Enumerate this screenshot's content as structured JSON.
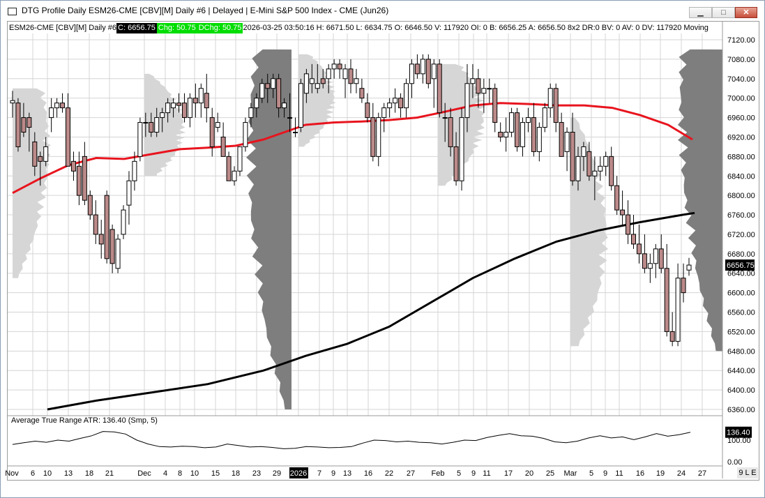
{
  "window": {
    "title": "DTG Profile Daily ESM26-CME [CBV][M]  Daily #6 | Delayed | E-Mini S&P 500 Index - CME (Jun26)",
    "minimize_glyph": "▁",
    "maximize_glyph": "□",
    "close_glyph": "✕"
  },
  "infobar": {
    "symbol": "ESM26-CME [CBV][M]  Daily #6 ",
    "last": "C: 6656.75",
    "chg": "Chg: 50.75",
    "dchg": "DChg: 50.75",
    "rest": " 2026-03-25 03:50:16 H: 6671.50 L: 6634.75 O: 6646.50 V: 117920 OI: 0 B: 6656.25 A: 6656.50 8x2 DR:0 BV: 0 AV: 0 DV: 117920 Moving"
  },
  "atr_panel": {
    "label": "Average True Range  ATR: 136.40   (Smp, 5)",
    "value_tag": "136.40"
  },
  "corner_button": "9 L E",
  "colors": {
    "up_candle": "#ffffff",
    "down_candle": "#bc8a8a",
    "ma_fast": "#e8141e",
    "ma_slow": "#000000",
    "profile_light": "#d6d6d6",
    "profile_dark": "#7e7e7e",
    "grid": "#d4d4d4",
    "last_price_tag": "#000000"
  },
  "chart_data": {
    "type": "candlestick",
    "price_axis": {
      "ylim": [
        6320,
        7140
      ],
      "ticks": [
        "7120.00",
        "7080.00",
        "7040.00",
        "7000.00",
        "6960.00",
        "6920.00",
        "6880.00",
        "6840.00",
        "6800.00",
        "6760.00",
        "6720.00",
        "6680.00",
        "6640.00",
        "6600.00",
        "6560.00",
        "6520.00",
        "6480.00",
        "6440.00",
        "6400.00",
        "6360.00"
      ],
      "last_price_label": "6656.75",
      "last_price": 6656.75
    },
    "date_axis": {
      "labels": [
        "Nov",
        "6",
        "10",
        "13",
        "18",
        "21",
        "Dec",
        "4",
        "8",
        "10",
        "15",
        "18",
        "23",
        "29",
        "2026",
        "7",
        "9",
        "13",
        "16",
        "22",
        "27",
        "Feb",
        "5",
        "9",
        "11",
        "17",
        "20",
        "25",
        "Mar",
        "5",
        "9",
        "11",
        "16",
        "19",
        "24",
        "27"
      ]
    },
    "candles": [
      [
        6990,
        7015,
        6960,
        6995
      ],
      [
        6990,
        7000,
        6890,
        6900
      ],
      [
        6960,
        6990,
        6920,
        6930
      ],
      [
        6960,
        6970,
        6890,
        6940
      ],
      [
        6910,
        6930,
        6840,
        6860
      ],
      [
        6880,
        6890,
        6820,
        6870
      ],
      [
        6870,
        6920,
        6860,
        6900
      ],
      [
        6960,
        7000,
        6930,
        6980
      ],
      [
        6980,
        7000,
        6960,
        6990
      ],
      [
        6990,
        7010,
        6970,
        6980
      ],
      [
        6980,
        7010,
        6860,
        6860
      ],
      [
        6870,
        6890,
        6830,
        6850
      ],
      [
        6860,
        6890,
        6780,
        6800
      ],
      [
        6880,
        6910,
        6780,
        6790
      ],
      [
        6800,
        6810,
        6750,
        6760
      ],
      [
        6760,
        6790,
        6700,
        6720
      ],
      [
        6720,
        6750,
        6670,
        6700
      ],
      [
        6800,
        6810,
        6660,
        6670
      ],
      [
        6730,
        6740,
        6640,
        6660
      ],
      [
        6650,
        6720,
        6640,
        6710
      ],
      [
        6720,
        6780,
        6710,
        6770
      ],
      [
        6780,
        6850,
        6740,
        6830
      ],
      [
        6830,
        6890,
        6810,
        6870
      ],
      [
        6880,
        6960,
        6870,
        6950
      ],
      [
        6950,
        6970,
        6920,
        6950
      ],
      [
        6950,
        6970,
        6920,
        6930
      ],
      [
        6930,
        6980,
        6920,
        6960
      ],
      [
        6960,
        6980,
        6930,
        6970
      ],
      [
        6970,
        7000,
        6950,
        6990
      ],
      [
        6980,
        7000,
        6960,
        6990
      ],
      [
        6990,
        7010,
        6970,
        6985
      ],
      [
        6990,
        7010,
        6950,
        6960
      ],
      [
        6960,
        7010,
        6940,
        7000
      ],
      [
        7000,
        7030,
        6960,
        6990
      ],
      [
        6990,
        7030,
        6960,
        7020
      ],
      [
        7010,
        7050,
        6950,
        6980
      ],
      [
        6960,
        6980,
        6880,
        6900
      ],
      [
        6940,
        6970,
        6930,
        6950
      ],
      [
        6920,
        6950,
        6880,
        6880
      ],
      [
        6880,
        6890,
        6830,
        6830
      ],
      [
        6830,
        6860,
        6820,
        6850
      ],
      [
        6850,
        6900,
        6840,
        6900
      ],
      [
        6900,
        6960,
        6890,
        6950
      ],
      [
        6960,
        6990,
        6940,
        6980
      ],
      [
        6980,
        7010,
        6960,
        7000
      ],
      [
        7000,
        7040,
        6990,
        7030
      ],
      [
        7030,
        7050,
        6990,
        7020
      ],
      [
        7020,
        7050,
        7000,
        7040
      ],
      [
        7040,
        7050,
        6960,
        6980
      ],
      [
        6980,
        7000,
        6960,
        6990
      ],
      [
        6960,
        7010,
        6930,
        6960
      ],
      [
        6930,
        6960,
        6920,
        6930
      ],
      [
        6940,
        7040,
        6930,
        7030
      ],
      [
        7010,
        7060,
        6990,
        7050
      ],
      [
        7030,
        7070,
        7010,
        7040
      ],
      [
        7020,
        7070,
        7010,
        7030
      ],
      [
        7040,
        7060,
        7020,
        7030
      ],
      [
        7040,
        7070,
        7010,
        7060
      ],
      [
        7060,
        7080,
        7040,
        7070
      ],
      [
        7070,
        7080,
        7040,
        7060
      ],
      [
        7040,
        7070,
        7000,
        7060
      ],
      [
        7060,
        7080,
        7010,
        7030
      ],
      [
        7030,
        7060,
        7010,
        7040
      ],
      [
        7020,
        7040,
        6990,
        7000
      ],
      [
        6990,
        7010,
        6950,
        6960
      ],
      [
        6960,
        6990,
        6870,
        6880
      ],
      [
        6880,
        6970,
        6860,
        6960
      ],
      [
        6960,
        6990,
        6930,
        6980
      ],
      [
        6980,
        7000,
        6960,
        6990
      ],
      [
        6990,
        7020,
        6970,
        7000
      ],
      [
        7000,
        7010,
        6960,
        6980
      ],
      [
        6980,
        7040,
        6960,
        7030
      ],
      [
        7030,
        7080,
        7000,
        7070
      ],
      [
        7070,
        7090,
        7040,
        7050
      ],
      [
        7050,
        7090,
        7030,
        7080
      ],
      [
        7080,
        7090,
        7020,
        7030
      ],
      [
        7040,
        7080,
        6980,
        7070
      ],
      [
        7070,
        7080,
        6960,
        6970
      ],
      [
        6960,
        6990,
        6910,
        6960
      ],
      [
        6960,
        6980,
        6880,
        6900
      ],
      [
        6900,
        6930,
        6820,
        6830
      ],
      [
        6830,
        6980,
        6810,
        6960
      ],
      [
        6960,
        7070,
        6930,
        7030
      ],
      [
        7030,
        7070,
        7000,
        7040
      ],
      [
        7040,
        7060,
        6980,
        7010
      ],
      [
        7010,
        7040,
        6970,
        7020
      ],
      [
        7020,
        7040,
        6990,
        7020
      ],
      [
        7020,
        7030,
        6930,
        6950
      ],
      [
        6930,
        6950,
        6910,
        6920
      ],
      [
        6920,
        6960,
        6890,
        6930
      ],
      [
        6930,
        6980,
        6920,
        6970
      ],
      [
        6970,
        6980,
        6890,
        6900
      ],
      [
        6900,
        6960,
        6880,
        6950
      ],
      [
        6950,
        6980,
        6930,
        6960
      ],
      [
        6960,
        6990,
        6880,
        6890
      ],
      [
        6890,
        6950,
        6870,
        6940
      ],
      [
        6940,
        6990,
        6930,
        6980
      ],
      [
        6980,
        7030,
        6960,
        7020
      ],
      [
        7020,
        7030,
        6930,
        6950
      ],
      [
        6950,
        6970,
        6880,
        6880
      ],
      [
        6890,
        6940,
        6850,
        6930
      ],
      [
        6930,
        6970,
        6820,
        6830
      ],
      [
        6830,
        6900,
        6810,
        6880
      ],
      [
        6880,
        6910,
        6850,
        6900
      ],
      [
        6890,
        6910,
        6830,
        6840
      ],
      [
        6840,
        6880,
        6790,
        6850
      ],
      [
        6850,
        6880,
        6830,
        6860
      ],
      [
        6860,
        6890,
        6840,
        6880
      ],
      [
        6880,
        6900,
        6810,
        6820
      ],
      [
        6820,
        6840,
        6760,
        6770
      ],
      [
        6770,
        6810,
        6740,
        6760
      ],
      [
        6760,
        6790,
        6700,
        6720
      ],
      [
        6720,
        6760,
        6690,
        6700
      ],
      [
        6700,
        6740,
        6660,
        6680
      ],
      [
        6680,
        6720,
        6640,
        6650
      ],
      [
        6650,
        6680,
        6620,
        6660
      ],
      [
        6660,
        6700,
        6630,
        6690
      ],
      [
        6690,
        6720,
        6640,
        6650
      ],
      [
        6650,
        6700,
        6510,
        6520
      ],
      [
        6520,
        6560,
        6490,
        6500
      ],
      [
        6500,
        6660,
        6490,
        6630
      ],
      [
        6630,
        6660,
        6580,
        6600
      ],
      [
        6646.5,
        6671.5,
        6634.75,
        6656.75
      ]
    ],
    "ma_fast_points": [
      [
        0,
        6805
      ],
      [
        40,
        6835
      ],
      [
        80,
        6862
      ],
      [
        120,
        6877
      ],
      [
        160,
        6875
      ],
      [
        200,
        6885
      ],
      [
        240,
        6895
      ],
      [
        280,
        6898
      ],
      [
        320,
        6902
      ],
      [
        360,
        6915
      ],
      [
        400,
        6935
      ],
      [
        420,
        6945
      ],
      [
        460,
        6950
      ],
      [
        500,
        6952
      ],
      [
        540,
        6955
      ],
      [
        580,
        6960
      ],
      [
        620,
        6972
      ],
      [
        660,
        6985
      ],
      [
        700,
        6990
      ],
      [
        740,
        6988
      ],
      [
        780,
        6985
      ],
      [
        820,
        6985
      ],
      [
        860,
        6980
      ],
      [
        900,
        6965
      ],
      [
        940,
        6945
      ],
      [
        975,
        6915
      ]
    ],
    "ma_slow_points": [
      [
        50,
        6360
      ],
      [
        120,
        6378
      ],
      [
        200,
        6395
      ],
      [
        280,
        6412
      ],
      [
        360,
        6440
      ],
      [
        420,
        6470
      ],
      [
        480,
        6495
      ],
      [
        540,
        6530
      ],
      [
        600,
        6580
      ],
      [
        660,
        6630
      ],
      [
        720,
        6670
      ],
      [
        780,
        6705
      ],
      [
        840,
        6728
      ],
      [
        900,
        6745
      ],
      [
        960,
        6760
      ],
      [
        978,
        6764
      ]
    ],
    "atr": {
      "ylim": [
        0,
        220
      ],
      "ticks": [
        "100.00",
        "0.00"
      ],
      "values": [
        80,
        88,
        95,
        90,
        100,
        95,
        108,
        120,
        140,
        138,
        128,
        100,
        82,
        70,
        68,
        72,
        70,
        65,
        68,
        82,
        75,
        68,
        70,
        66,
        60,
        62,
        70,
        68,
        65,
        66,
        70,
        86,
        100,
        98,
        92,
        95,
        90,
        88,
        82,
        90,
        100,
        98,
        112,
        122,
        130,
        120,
        118,
        108,
        92,
        88,
        95,
        110,
        120,
        110,
        115,
        102,
        115,
        130,
        118,
        125,
        136
      ]
    }
  }
}
